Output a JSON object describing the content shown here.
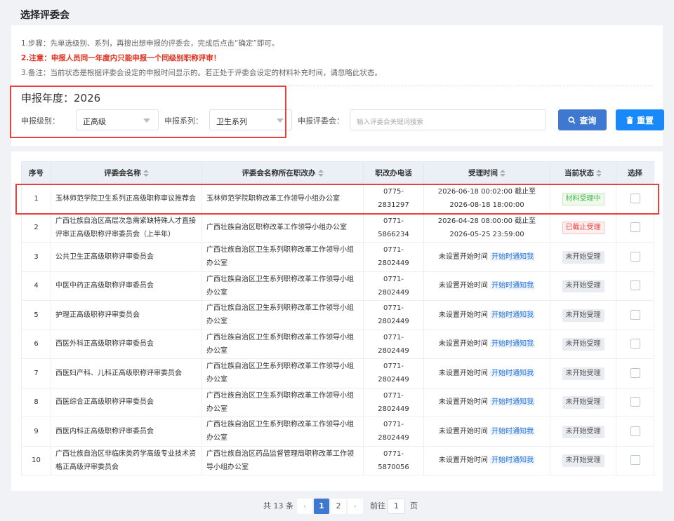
{
  "page": {
    "title": "选择评委会"
  },
  "notes": {
    "step": "1.步骤：先单选级别、系列，再搜出想申报的评委会，完成后点击“确定”即可。",
    "warning": "2.注意：申报人员同一年度内只能申报一个同级别职称评审！",
    "remark": "3.备注：当前状态是根据评委会设定的申报时间显示的。若正处于评委会设定的材料补充时间，请忽略此状态。"
  },
  "filters": {
    "year_label": "申报年度：2026",
    "level_label": "申报级别：",
    "level_value": "正高级",
    "series_label": "申报系列：",
    "series_value": "卫生系列",
    "committee_label": "申报评委会：",
    "committee_placeholder": "输入评委会关键词搜索",
    "query_button": "查询",
    "reset_button": "重置"
  },
  "table": {
    "headers": [
      "序号",
      "评委会名称",
      "评委会名称所在职改办",
      "职改办电话",
      "受理时间",
      "当前状态",
      "选择"
    ],
    "rows": [
      {
        "no": "1",
        "name": "玉林师范学院卫生系列正高级职称审议推荐会",
        "office": "玉林师范学院职称改革工作领导小组办公室",
        "phone": "0775-2831297",
        "time": "2026-06-18 00:02:00 截止至 2026-08-18 18:00:00",
        "notify": "",
        "status": "材料受理中"
      },
      {
        "no": "2",
        "name": "广西壮族自治区高层次急需紧缺特殊人才直接评审正高级职称评审委员会（上半年）",
        "office": "广西壮族自治区职称改革工作领导小组办公室",
        "phone": "0771-5866234",
        "time": "2026-04-28 08:00:00 截止至 2026-05-25 23:59:00",
        "notify": "",
        "status": "已截止受理"
      },
      {
        "no": "3",
        "name": "公共卫生正高级职称评审委员会",
        "office": "广西壮族自治区卫生系列职称改革工作领导小组办公室",
        "phone": "0771-2802449",
        "time": "未设置开始时间",
        "notify": "开始时通知我",
        "status": "未开始受理"
      },
      {
        "no": "4",
        "name": "中医中药正高级职称评审委员会",
        "office": "广西壮族自治区卫生系列职称改革工作领导小组办公室",
        "phone": "0771-2802449",
        "time": "未设置开始时间",
        "notify": "开始时通知我",
        "status": "未开始受理"
      },
      {
        "no": "5",
        "name": "护理正高级职称评审委员会",
        "office": "广西壮族自治区卫生系列职称改革工作领导小组办公室",
        "phone": "0771-2802449",
        "time": "未设置开始时间",
        "notify": "开始时通知我",
        "status": "未开始受理"
      },
      {
        "no": "6",
        "name": "西医外科正高级职称评审委员会",
        "office": "广西壮族自治区卫生系列职称改革工作领导小组办公室",
        "phone": "0771-2802449",
        "time": "未设置开始时间",
        "notify": "开始时通知我",
        "status": "未开始受理"
      },
      {
        "no": "7",
        "name": "西医妇产科、儿科正高级职称评审委员会",
        "office": "广西壮族自治区卫生系列职称改革工作领导小组办公室",
        "phone": "0771-2802449",
        "time": "未设置开始时间",
        "notify": "开始时通知我",
        "status": "未开始受理"
      },
      {
        "no": "8",
        "name": "西医综合正高级职称评审委员会",
        "office": "广西壮族自治区卫生系列职称改革工作领导小组办公室",
        "phone": "0771-2802449",
        "time": "未设置开始时间",
        "notify": "开始时通知我",
        "status": "未开始受理"
      },
      {
        "no": "9",
        "name": "西医内科正高级职称评审委员会",
        "office": "广西壮族自治区卫生系列职称改革工作领导小组办公室",
        "phone": "0771-2802449",
        "time": "未设置开始时间",
        "notify": "开始时通知我",
        "status": "未开始受理"
      },
      {
        "no": "10",
        "name": "广西壮族自治区非临床类药学高级专业技术资格正高级评审委员会",
        "office": "广西壮族自治区药品监督管理局职称改革工作领导小组办公室",
        "phone": "0771-5870056",
        "time": "未设置开始时间",
        "notify": "开始时通知我",
        "status": "未开始受理"
      }
    ]
  },
  "pagination": {
    "total": "共 13 条",
    "pages": [
      "1",
      "2"
    ],
    "goto_label": "前往",
    "goto_value": "1",
    "page_suffix": "页"
  },
  "colors": {
    "primary": "#3f78d0",
    "highlight": "#e8413c",
    "status_active": "#3dbb4d",
    "status_closed": "#e8413c"
  }
}
